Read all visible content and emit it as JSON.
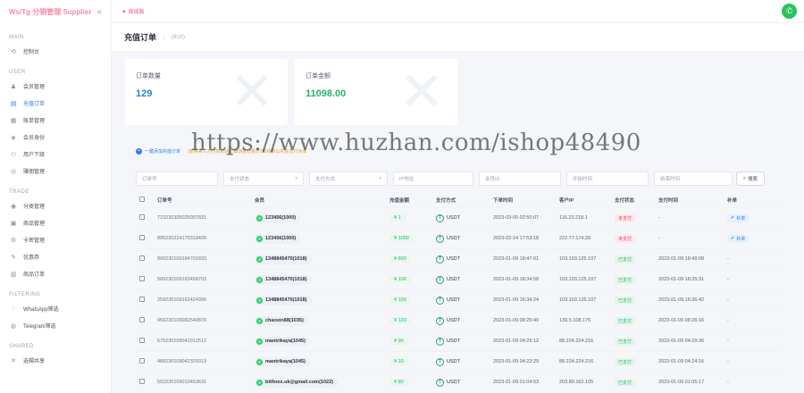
{
  "brand": {
    "name": "Ws/Tg 分销管理 Supplier",
    "collapse_icon": "double-chevron-left-icon"
  },
  "sidebar": {
    "groups": [
      {
        "title": "MAIN",
        "items": [
          {
            "label": "控制台",
            "icon": "dashboard-icon",
            "active": false
          }
        ]
      },
      {
        "title": "USER",
        "items": [
          {
            "label": "会员管理",
            "icon": "user-icon",
            "active": false
          },
          {
            "label": "充值订单",
            "icon": "order-icon",
            "active": true
          },
          {
            "label": "账单管理",
            "icon": "bill-icon",
            "active": false
          },
          {
            "label": "会员身份",
            "icon": "identity-icon",
            "active": false
          },
          {
            "label": "用户下级",
            "icon": "subordinate-icon",
            "active": false
          },
          {
            "label": "赚佣管理",
            "icon": "commission-icon",
            "active": false
          }
        ]
      },
      {
        "title": "TRADE",
        "items": [
          {
            "label": "分类管理",
            "icon": "category-icon",
            "active": false
          },
          {
            "label": "商品管理",
            "icon": "goods-icon",
            "active": false
          },
          {
            "label": "卡密管理",
            "icon": "card-icon",
            "active": false
          },
          {
            "label": "优惠券",
            "icon": "coupon-icon",
            "active": false
          },
          {
            "label": "商品订单",
            "icon": "goods-order-icon",
            "active": false
          }
        ]
      },
      {
        "title": "FILTERING",
        "items": [
          {
            "label": "WhatsApp筛选",
            "icon": "whatsapp-icon",
            "active": false
          },
          {
            "label": "Telegram筛选",
            "icon": "telegram-icon",
            "active": false
          }
        ]
      },
      {
        "title": "SHARED",
        "items": [
          {
            "label": "选辑共享",
            "icon": "share-icon",
            "active": false
          }
        ]
      }
    ]
  },
  "topbar": {
    "breadcrumb": "商城版"
  },
  "page": {
    "title": "充值订单",
    "subtitle": "(9U0)"
  },
  "stats": [
    {
      "label": "订单数量",
      "value": "129",
      "color": "#2f7de1"
    },
    {
      "label": "订单金额",
      "value": "11098.00",
      "color": "#29b36a"
    }
  ],
  "notice": {
    "text": "一键添加充值订单",
    "warning": "(使用第三方付款的话已取消此功能)订单结果以实际支付为准"
  },
  "watermark": "https://www.huzhan.com/ishop48490",
  "filters": {
    "order_no": "订单号",
    "pay_status": "支付状态",
    "pay_method": "支付方式",
    "ip": "IP地址",
    "member": "会员ID",
    "start_time": "开始时间",
    "end_time": "结束时间",
    "search": "搜索"
  },
  "table": {
    "columns": {
      "order_no": "订单号",
      "member": "会员",
      "amount": "充值金额",
      "pay_method": "支付方式",
      "order_time": "下单时间",
      "client_ip": "客户IP",
      "pay_status": "支付状态",
      "pay_time": "支付时间",
      "fix": "补单"
    },
    "rows": [
      {
        "order_no": "723230305025007831",
        "member": "123456(1000)",
        "amount": "¥ 1",
        "pay_method": "USDT",
        "order_time": "2023-03-05 02:50:07",
        "client_ip": "116.23.218.1",
        "pay_status": "未支付",
        "status_type": "unpaid",
        "pay_time": "-",
        "fix": "补单"
      },
      {
        "order_no": "895230224175318426",
        "member": "123456(1000)",
        "amount": "¥ 1000",
        "pay_method": "USDT",
        "order_time": "2023-02-24 17:53:18",
        "client_ip": "222.77.174.39",
        "pay_status": "未支付",
        "status_type": "unpaid",
        "pay_time": "-",
        "fix": "补单"
      },
      {
        "order_no": "800230109184701833",
        "member": "1348845470(1018)",
        "amount": "¥ 600",
        "pay_method": "USDT",
        "order_time": "2023-01-09 18:47:01",
        "client_ip": "103.193.125.107",
        "pay_status": "已支付",
        "status_type": "paid",
        "pay_time": "2023-01-09 18:49:08",
        "fix": "-"
      },
      {
        "order_no": "589230109183458703",
        "member": "1348845470(1018)",
        "amount": "¥ 100",
        "pay_method": "USDT",
        "order_time": "2023-01-09 18:34:58",
        "client_ip": "103.193.125.107",
        "pay_status": "已支付",
        "status_type": "paid",
        "pay_time": "2023-01-09 18:35:31",
        "fix": "-"
      },
      {
        "order_no": "259230109163424390",
        "member": "1348845470(1018)",
        "amount": "¥ 100",
        "pay_method": "USDT",
        "order_time": "2023-01-09 16:34:24",
        "client_ip": "103.193.125.107",
        "pay_status": "已支付",
        "status_type": "paid",
        "pay_time": "2023-01-09 16:36:42",
        "fix": "-"
      },
      {
        "order_no": "956230109082549876",
        "member": "chaoxin88(1035)",
        "amount": "¥ 120",
        "pay_method": "USDT",
        "order_time": "2023-01-09 08:25:49",
        "client_ip": "139.5.108.175",
        "pay_status": "已支付",
        "status_type": "paid",
        "pay_time": "2023-01-09 08:26:16",
        "fix": "-"
      },
      {
        "order_no": "575230109042912512",
        "member": "mantrikaya(1045)",
        "amount": "¥ 90",
        "pay_method": "USDT",
        "order_time": "2023-01-09 04:29:12",
        "client_ip": "88.224.224.216",
        "pay_status": "已支付",
        "status_type": "paid",
        "pay_time": "2023-01-09 04:29:36",
        "fix": "-"
      },
      {
        "order_no": "488230109042329313",
        "member": "mantrikaya(1045)",
        "amount": "¥ 10",
        "pay_method": "USDT",
        "order_time": "2023-01-09 04:23:29",
        "client_ip": "88.224.224.216",
        "pay_status": "已支付",
        "status_type": "paid",
        "pay_time": "2023-01-09 04:24:16",
        "fix": "-"
      },
      {
        "order_no": "502230109010453631",
        "member": "bitfinex.uk@gmail.com(1022)",
        "amount": "¥ 80",
        "pay_method": "USDT",
        "order_time": "2023-01-09 01:04:53",
        "client_ip": "203.80.162.105",
        "pay_status": "已支付",
        "status_type": "paid",
        "pay_time": "2023-01-09 01:05:17",
        "fix": "-"
      }
    ]
  }
}
